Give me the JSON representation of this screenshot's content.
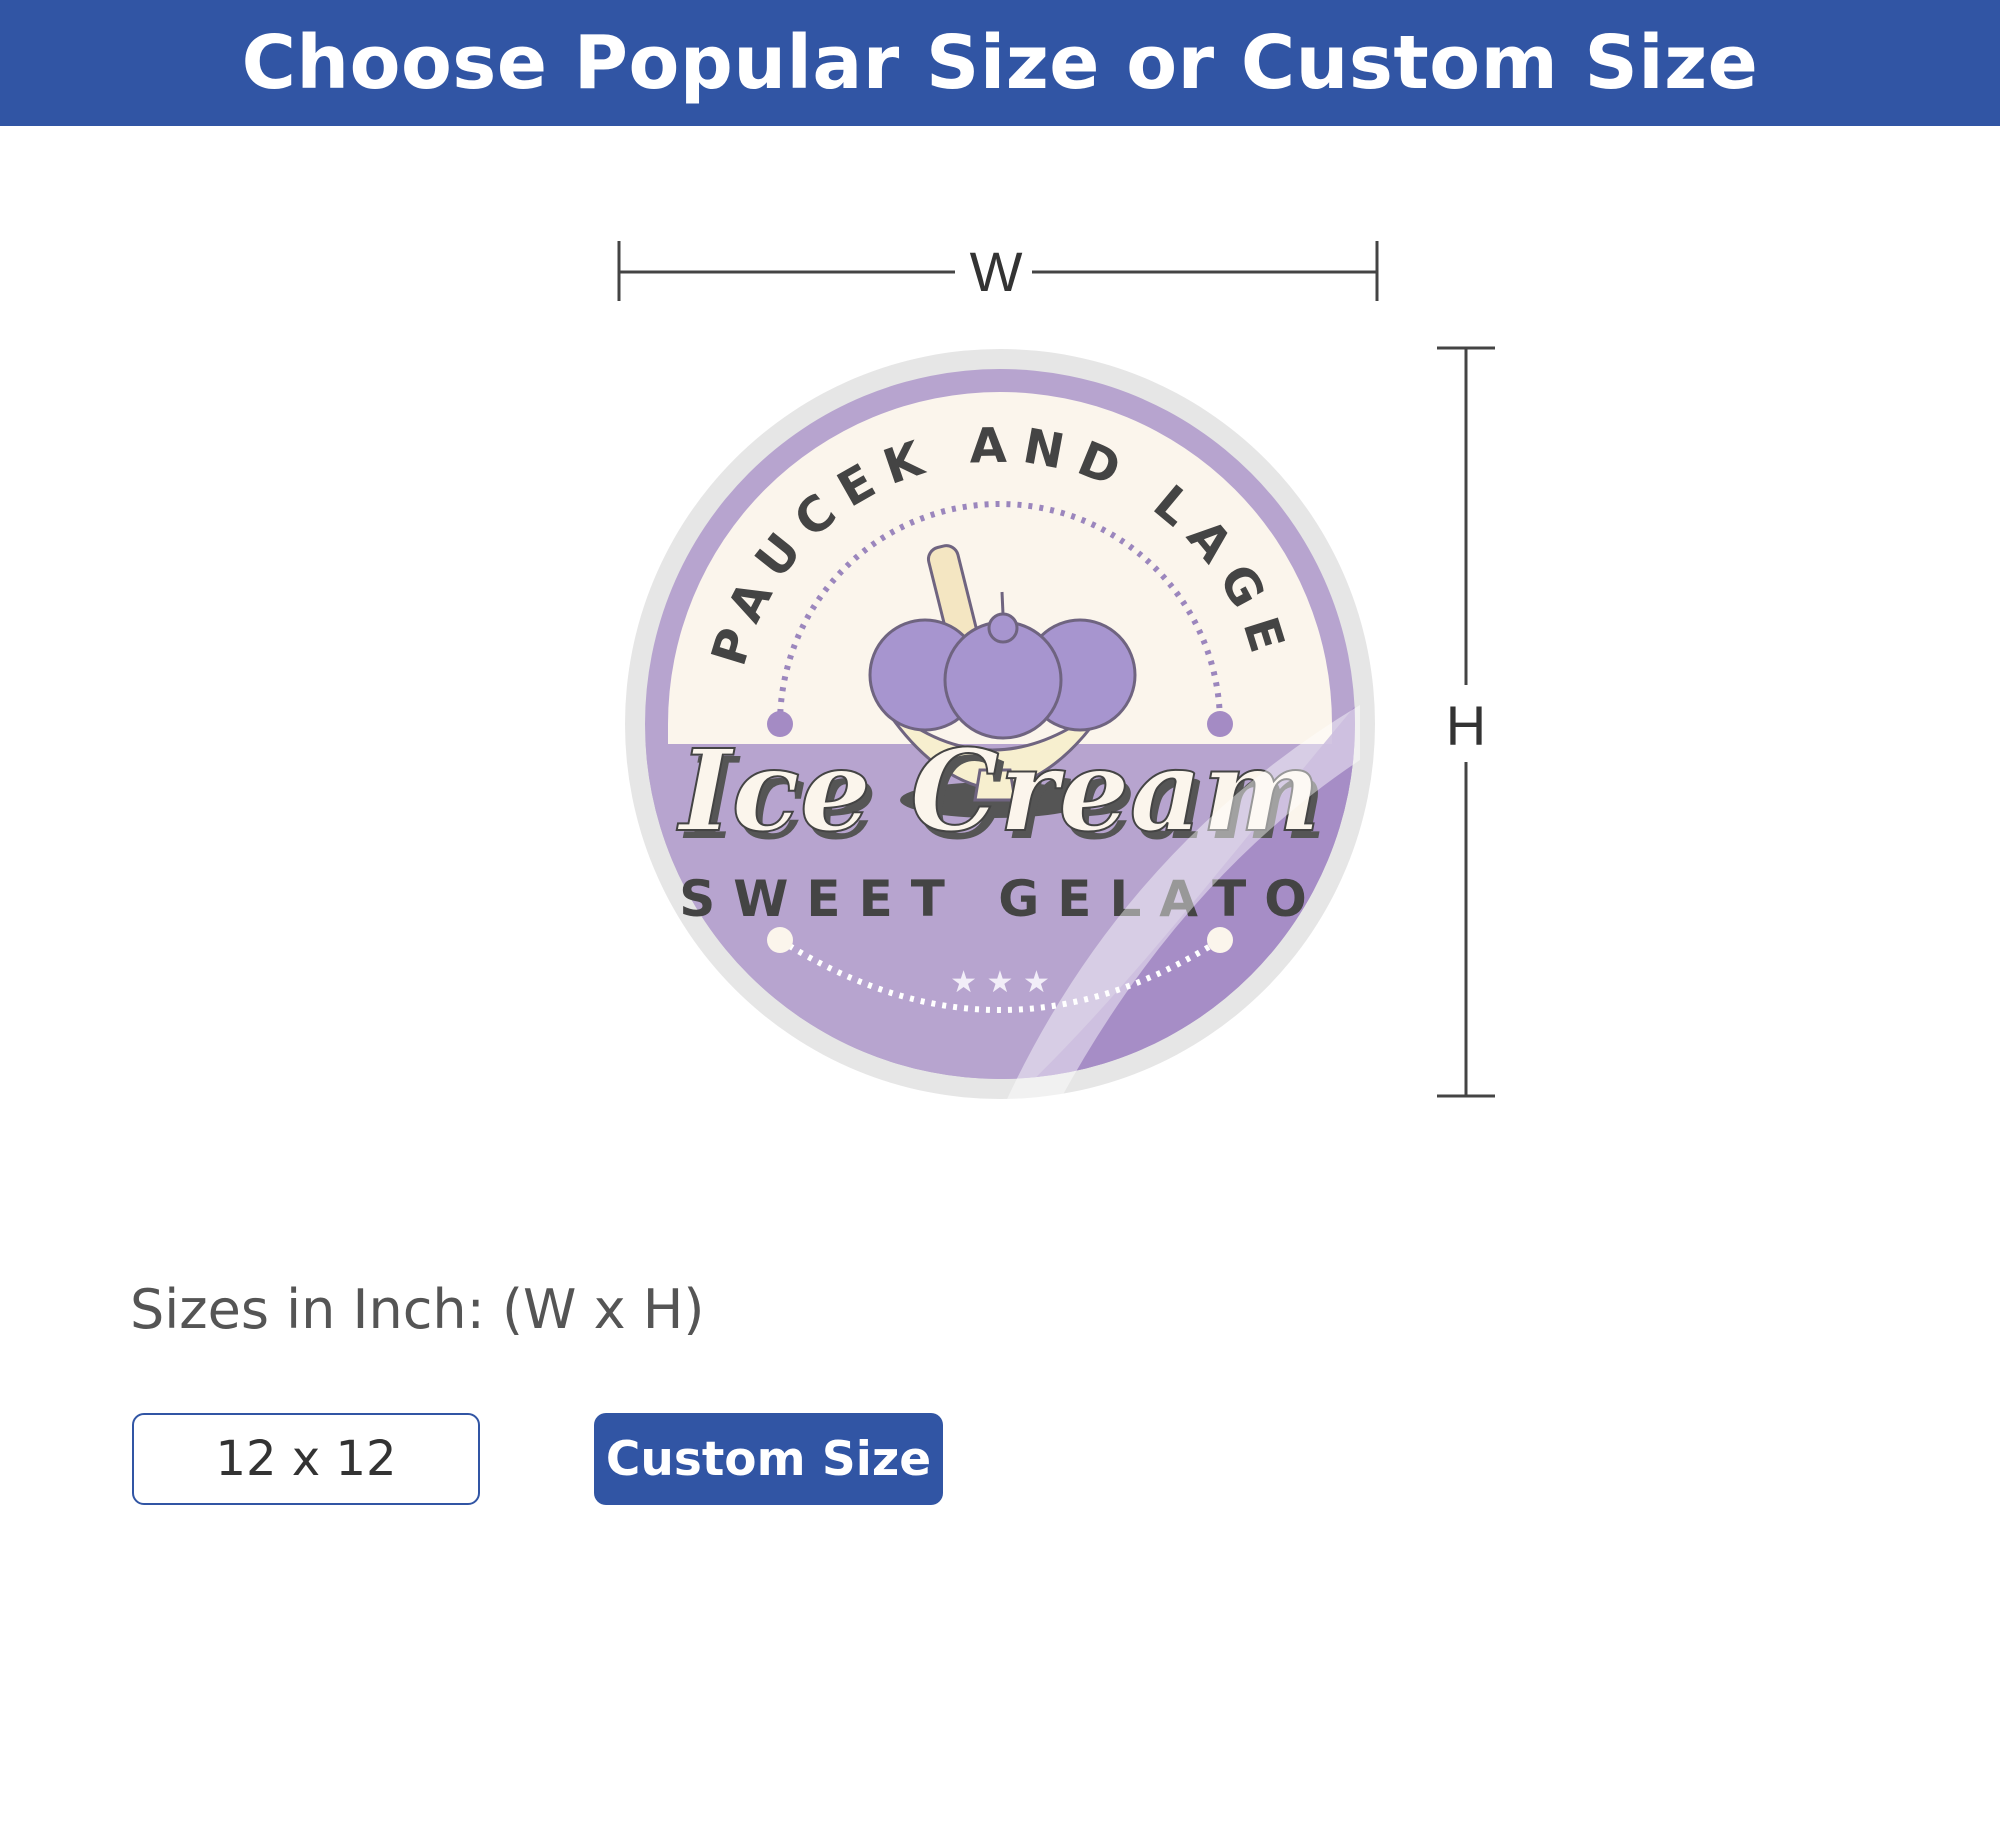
{
  "header": {
    "title": "Choose Popular Size or Custom Size"
  },
  "dimensions": {
    "width_label": "W",
    "height_label": "H"
  },
  "sticker": {
    "top_arc_text": "PAUCEK AND LAGE",
    "title": "Ice Cream",
    "subtitle": "SWEET GELATO",
    "stars": "★ ★ ★",
    "colors": {
      "purple": "#b7a4cf",
      "cream": "#fbf5ec",
      "dark": "#444444",
      "border": "#e6e6e6"
    }
  },
  "sizes": {
    "label": "Sizes in Inch: (W x H)",
    "options": [
      {
        "label": "12 x 12",
        "selected": false
      }
    ],
    "custom_label": "Custom Size"
  },
  "colors": {
    "brand": "#3155a4",
    "text": "#555555"
  }
}
